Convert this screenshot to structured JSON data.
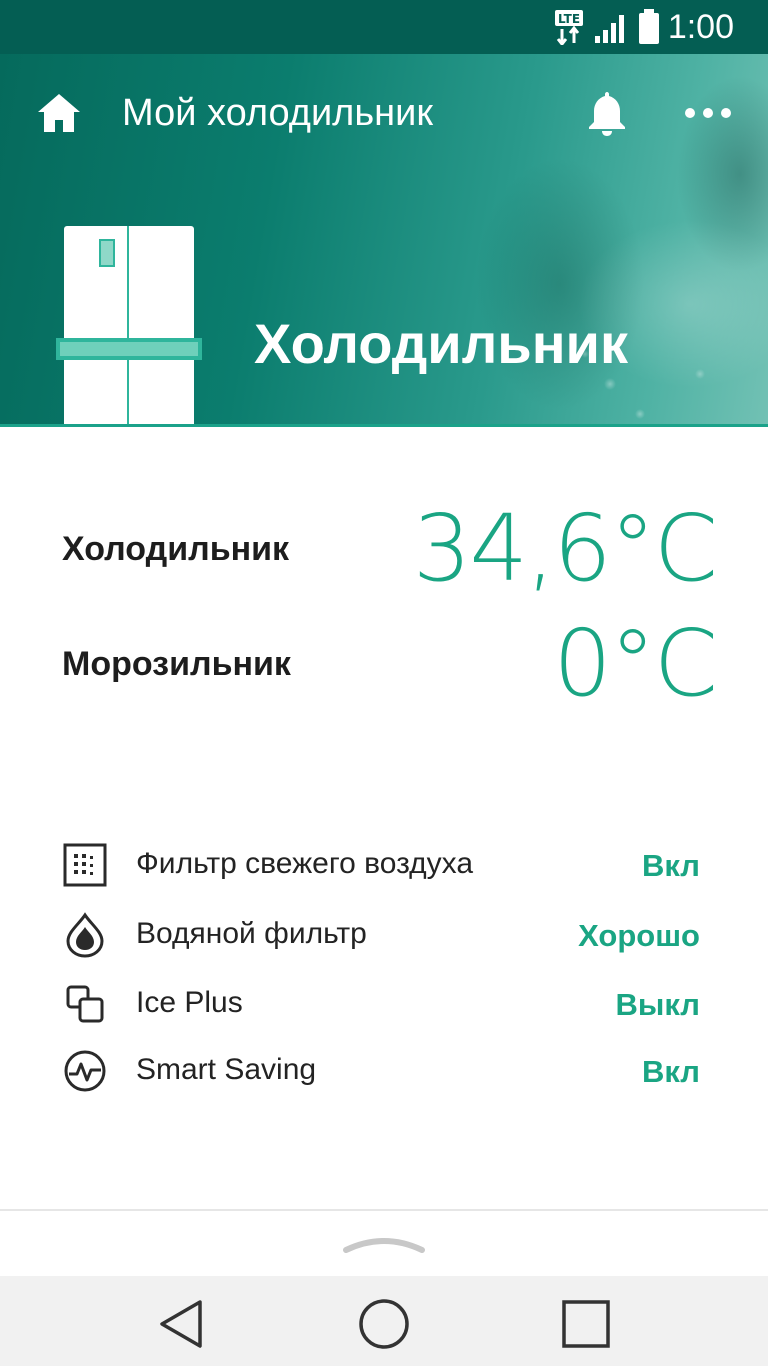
{
  "status_bar": {
    "network_badge": "LTE",
    "time": "1:00",
    "icons": [
      "lte-data-icon",
      "signal-icon",
      "battery-icon"
    ]
  },
  "app_bar": {
    "title": "Мой холодильник",
    "icons": [
      "home-icon",
      "bell-icon",
      "more-icon"
    ]
  },
  "hero": {
    "title": "Холодильник",
    "illustration": "fridge-icon"
  },
  "temperatures": [
    {
      "label": "Холодильник",
      "value": "34,6°C"
    },
    {
      "label": "Морозильник",
      "value": "0°C"
    }
  ],
  "features": [
    {
      "icon": "air-filter-icon",
      "label": "Фильтр свежего воздуха",
      "status": "Вкл"
    },
    {
      "icon": "water-drop-icon",
      "label": "Водяной фильтр",
      "status": "Хорошо"
    },
    {
      "icon": "ice-cubes-icon",
      "label": "Ice Plus",
      "status": "Выкл"
    },
    {
      "icon": "smart-saving-icon",
      "label": "Smart Saving",
      "status": "Вкл"
    }
  ],
  "navigation": {
    "icons": [
      "back-icon",
      "home-circle-icon",
      "recents-icon"
    ]
  },
  "colors": {
    "status_bar": "#045e53",
    "accent": "#1aa583",
    "hero_start": "#056a5c",
    "hero_end": "#72c1b4",
    "nav_bar": "#f1f1f1"
  }
}
